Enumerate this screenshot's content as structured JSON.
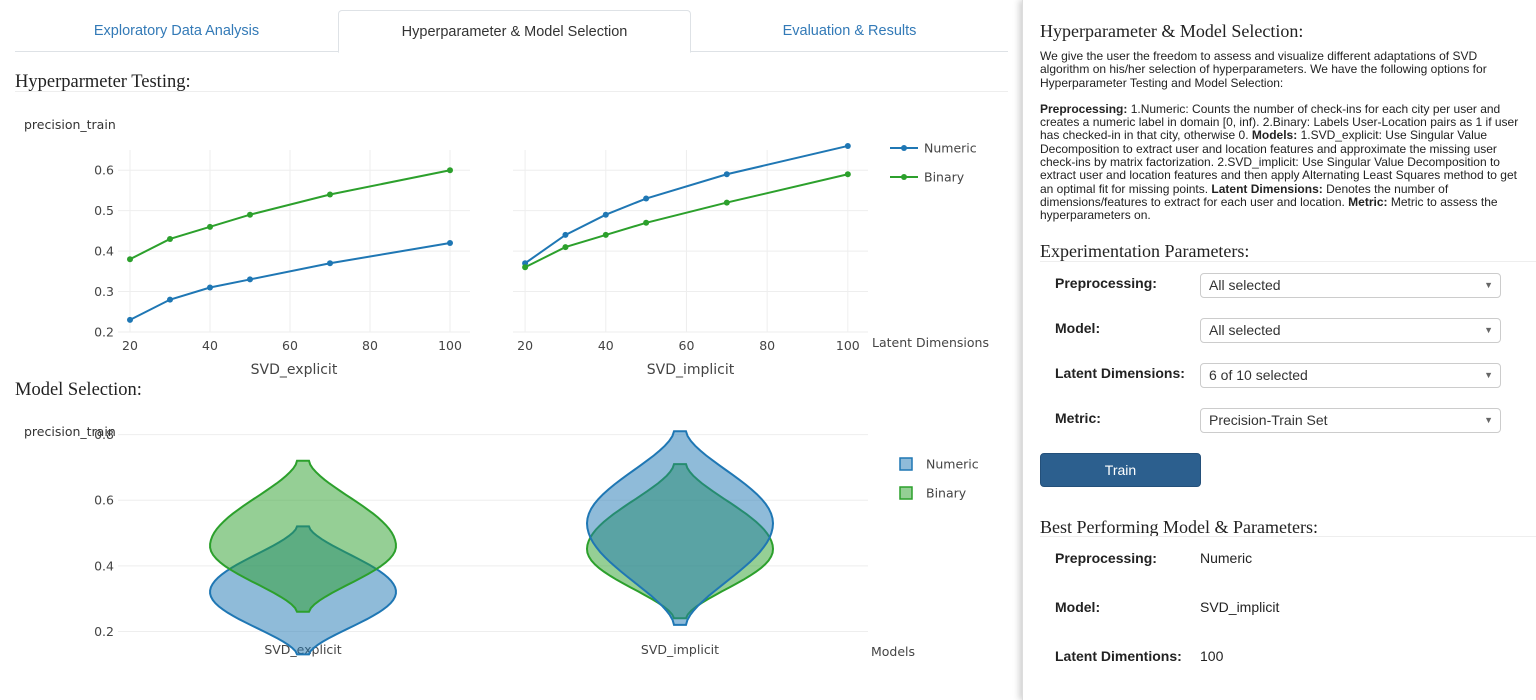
{
  "tabs": [
    {
      "label": "Exploratory Data Analysis",
      "active": false
    },
    {
      "label": "Hyperparameter & Model Selection",
      "active": true
    },
    {
      "label": "Evaluation & Results",
      "active": false
    }
  ],
  "sections": {
    "hyper_title": "Hyperparmeter Testing:",
    "model_title": "Model Selection:"
  },
  "colors": {
    "numeric": "#1f77b4",
    "binary": "#2ca02c",
    "button": "#2c5f8e"
  },
  "chart_data": [
    {
      "type": "line",
      "ylabel": "precision_train",
      "xlabel": "Latent Dimensions",
      "ylim": [
        0.2,
        0.65
      ],
      "yticks": [
        0.2,
        0.3,
        0.4,
        0.5,
        0.6
      ],
      "xlim": [
        17,
        105
      ],
      "xticks": [
        20,
        40,
        60,
        80,
        100
      ],
      "grid": true,
      "legend": "right",
      "panels": [
        {
          "title": "SVD_explicit",
          "x": [
            20,
            30,
            40,
            50,
            70,
            100
          ],
          "series": [
            {
              "name": "Numeric",
              "values": [
                0.23,
                0.28,
                0.31,
                0.33,
                0.37,
                0.42
              ]
            },
            {
              "name": "Binary",
              "values": [
                0.38,
                0.43,
                0.46,
                0.49,
                0.54,
                0.6
              ]
            }
          ]
        },
        {
          "title": "SVD_implicit",
          "x": [
            20,
            30,
            40,
            50,
            70,
            100
          ],
          "series": [
            {
              "name": "Numeric",
              "values": [
                0.37,
                0.44,
                0.49,
                0.53,
                0.59,
                0.66
              ]
            },
            {
              "name": "Binary",
              "values": [
                0.36,
                0.41,
                0.44,
                0.47,
                0.52,
                0.59
              ]
            }
          ]
        }
      ]
    },
    {
      "type": "violin",
      "ylabel": "precision_train",
      "xlabel": "Models",
      "ylim": [
        0.18,
        0.82
      ],
      "yticks": [
        0.2,
        0.4,
        0.6,
        0.8
      ],
      "grid": true,
      "legend": "right",
      "categories": [
        "SVD_explicit",
        "SVD_implicit"
      ],
      "series": [
        {
          "name": "Numeric",
          "values": [
            {
              "min": 0.13,
              "max": 0.52,
              "mode": 0.32
            },
            {
              "min": 0.22,
              "max": 0.81,
              "mode": 0.53
            }
          ]
        },
        {
          "name": "Binary",
          "values": [
            {
              "min": 0.26,
              "max": 0.72,
              "mode": 0.46
            },
            {
              "min": 0.24,
              "max": 0.71,
              "mode": 0.45
            }
          ]
        }
      ]
    }
  ],
  "panel": {
    "title": "Hyperparameter & Model Selection:",
    "intro": "We give the user the freedom to assess and visualize different adaptations of SVD algorithm on his/her selection of hyperparameters. We have the following options for Hyperparameter Testing and Model Selection:",
    "desc": [
      {
        "b": "Preprocessing:",
        "t": " 1.Numeric: Counts the number of check-ins for each city per user and creates a numeric label in domain [0, inf). 2.Binary: Labels User-Location pairs as 1 if user has checked-in in that city, otherwise 0. "
      },
      {
        "b": "Models:",
        "t": " 1.SVD_explicit: Use Singular Value Decomposition to extract user and location features and approximate the missing user check-ins by matrix factorization. 2.SVD_implicit: Use Singular Value Decomposition to extract user and location features and then apply Alternating Least Squares method to get an optimal fit for missing points. "
      },
      {
        "b": "Latent Dimensions:",
        "t": " Denotes the number of dimensions/features to extract for each user and location. "
      },
      {
        "b": "Metric:",
        "t": " Metric to assess the hyperparameters on."
      }
    ],
    "params_title": "Experimentation Parameters:",
    "params": [
      {
        "label": "Preprocessing:",
        "value": "All selected"
      },
      {
        "label": "Model:",
        "value": "All selected"
      },
      {
        "label": "Latent Dimensions:",
        "value": "6 of 10 selected"
      },
      {
        "label": "Metric:",
        "value": "Precision-Train Set"
      }
    ],
    "train_label": "Train",
    "best_title": "Best Performing Model & Parameters:",
    "best": [
      {
        "label": "Preprocessing:",
        "value": "Numeric"
      },
      {
        "label": "Model:",
        "value": "SVD_implicit"
      },
      {
        "label": "Latent Dimentions:",
        "value": "100"
      }
    ]
  }
}
